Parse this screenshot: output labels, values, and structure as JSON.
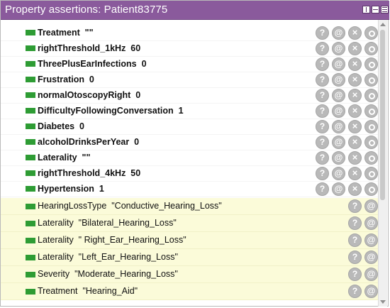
{
  "window": {
    "title": "Property assertions: Patient83775"
  },
  "icons": {
    "explain": "?",
    "annotate": "@",
    "delete": "×"
  },
  "colors": {
    "titlebar": "#8a5a9c",
    "assertion_marker": "#2e9c34",
    "inferred_background": "#fbfbd9",
    "button_grey": "#b9b9b9"
  },
  "asserted_assertions": [
    {
      "text": "Treatment  \"\""
    },
    {
      "text": "rightThreshold_1kHz  60"
    },
    {
      "text": "ThreePlusEarInfections  0"
    },
    {
      "text": "Frustration  0"
    },
    {
      "text": "normalOtoscopyRight  0"
    },
    {
      "text": "DifficultyFollowingConversation  1"
    },
    {
      "text": "Diabetes  0"
    },
    {
      "text": "alcoholDrinksPerYear  0"
    },
    {
      "text": "Laterality  \"\""
    },
    {
      "text": "rightThreshold_4kHz  50"
    },
    {
      "text": "Hypertension  1"
    }
  ],
  "inferred_assertions": [
    {
      "text": "HearingLossType  \"Conductive_Hearing_Loss\""
    },
    {
      "text": "Laterality  \"Bilateral_Hearing_Loss\""
    },
    {
      "text": "Laterality  \" Right_Ear_Hearing_Loss\""
    },
    {
      "text": "Laterality  \"Left_Ear_Hearing_Loss\""
    },
    {
      "text": "Severity  \"Moderate_Hearing_Loss\""
    },
    {
      "text": "Treatment  \"Hearing_Aid\""
    }
  ]
}
